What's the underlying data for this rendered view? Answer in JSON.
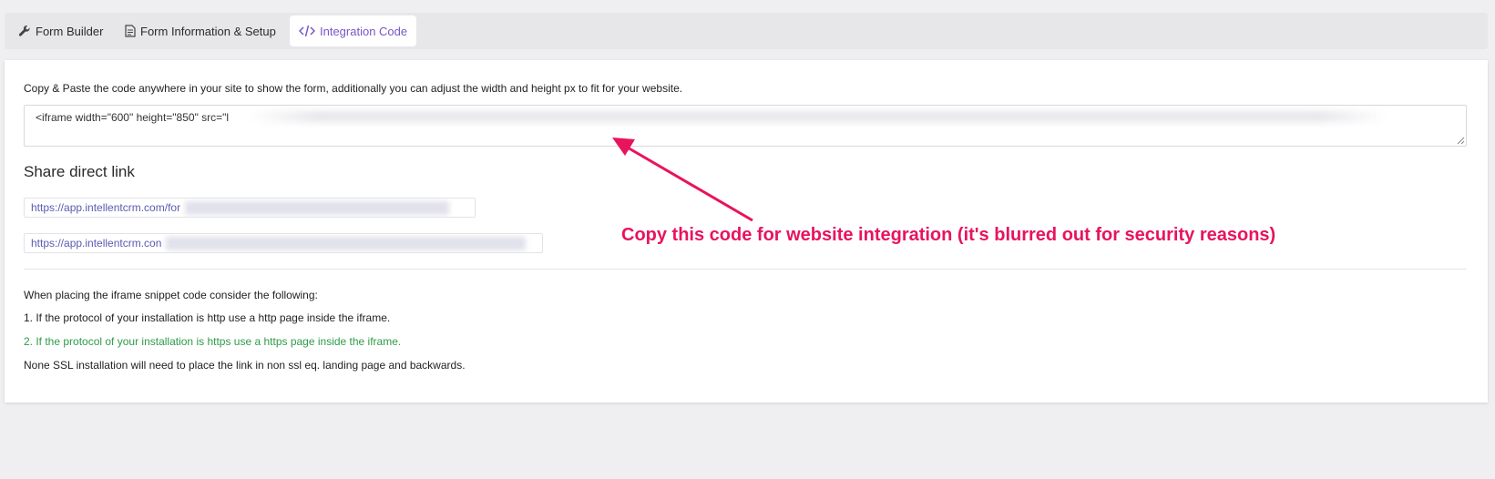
{
  "tabs": [
    {
      "label": "Form Builder",
      "icon": "wrench-icon"
    },
    {
      "label": "Form Information & Setup",
      "icon": "document-icon"
    },
    {
      "label": "Integration Code",
      "icon": "code-icon"
    }
  ],
  "integration": {
    "intro": "Copy & Paste the code anywhere in your site to show the form, additionally you can adjust the width and height px to fit for your website.",
    "code_value": "<iframe width=\"600\" height=\"850\" src=\"l"
  },
  "share": {
    "title": "Share direct link",
    "links": [
      "https://app.intellentcrm.com/for",
      "https://app.intellentcrm.con"
    ]
  },
  "notes": [
    "When placing the iframe snippet code consider the following:",
    "1. If the protocol of your installation is http use a http page inside the iframe.",
    "2. If the protocol of your installation is https use a https page inside the iframe.",
    "None SSL installation will need to place the link in non ssl eq. landing page and backwards."
  ],
  "annotation": {
    "text": "Copy this code for website integration (it's blurred out for security reasons)",
    "color": "#e8135e"
  },
  "colors": {
    "accent": "#7b54c9",
    "success": "#2e9b4a",
    "link": "#5b5bb0"
  }
}
